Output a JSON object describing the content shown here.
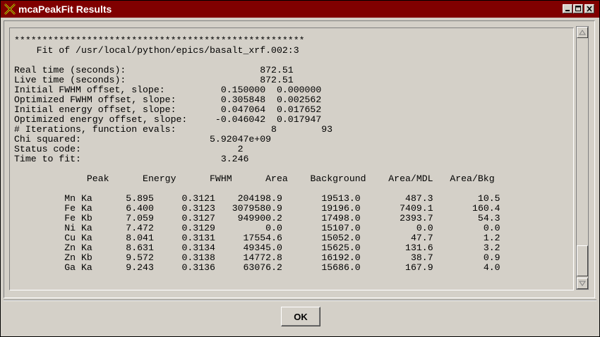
{
  "window": {
    "title": "mcaPeakFit Results",
    "icon": "x-close-icon",
    "controls": [
      "minimize-icon",
      "maximize-icon",
      "close-icon"
    ]
  },
  "output": {
    "separator": "****************************************************",
    "header": "    Fit of /usr/local/python/epics/basalt_xrf.002:3",
    "params": [
      {
        "label": "Real time (seconds):",
        "value": "872.51"
      },
      {
        "label": "Live time (seconds):",
        "value": "872.51"
      },
      {
        "label": "Initial FWHM offset, slope:",
        "value": "0.150000  0.000000"
      },
      {
        "label": "Optimized FWHM offset, slope:",
        "value": "0.305848  0.002562"
      },
      {
        "label": "Initial energy offset, slope:",
        "value": "0.047064  0.017652"
      },
      {
        "label": "Optimized energy offset, slope:",
        "value": "-0.046042  0.017947"
      },
      {
        "label": "# Iterations, function evals:",
        "value": "8        93"
      },
      {
        "label": "Chi squared:",
        "value": "5.92047e+09"
      },
      {
        "label": "Status code:",
        "value": "2"
      },
      {
        "label": "Time to fit:",
        "value": "3.246"
      }
    ],
    "table": {
      "columns": [
        "Peak",
        "Energy",
        "FWHM",
        "Area",
        "Background",
        "Area/MDL",
        "Area/Bkg"
      ],
      "rows": [
        [
          "Mn Ka",
          "5.895",
          "0.3121",
          "204198.9",
          "19513.0",
          "487.3",
          "10.5"
        ],
        [
          "Fe Ka",
          "6.400",
          "0.3123",
          "3079580.9",
          "19196.0",
          "7409.1",
          "160.4"
        ],
        [
          "Fe Kb",
          "7.059",
          "0.3127",
          "949900.2",
          "17498.0",
          "2393.7",
          "54.3"
        ],
        [
          "Ni Ka",
          "7.472",
          "0.3129",
          "0.0",
          "15107.0",
          "0.0",
          "0.0"
        ],
        [
          "Cu Ka",
          "8.041",
          "0.3131",
          "17554.6",
          "15052.0",
          "47.7",
          "1.2"
        ],
        [
          "Zn Ka",
          "8.631",
          "0.3134",
          "49345.0",
          "15625.0",
          "131.6",
          "3.2"
        ],
        [
          "Zn Kb",
          "9.572",
          "0.3138",
          "14772.8",
          "16192.0",
          "38.7",
          "0.9"
        ],
        [
          "Ga Ka",
          "9.243",
          "0.3136",
          "63076.2",
          "15686.0",
          "167.9",
          "4.0"
        ]
      ]
    }
  },
  "scrollbar": {
    "up_icon": "arrow-up-icon",
    "down_icon": "arrow-down-icon",
    "position": 0.88
  },
  "ok_label": "OK",
  "colors": {
    "titlebar": "#800000",
    "face": "#d4d0c8"
  }
}
